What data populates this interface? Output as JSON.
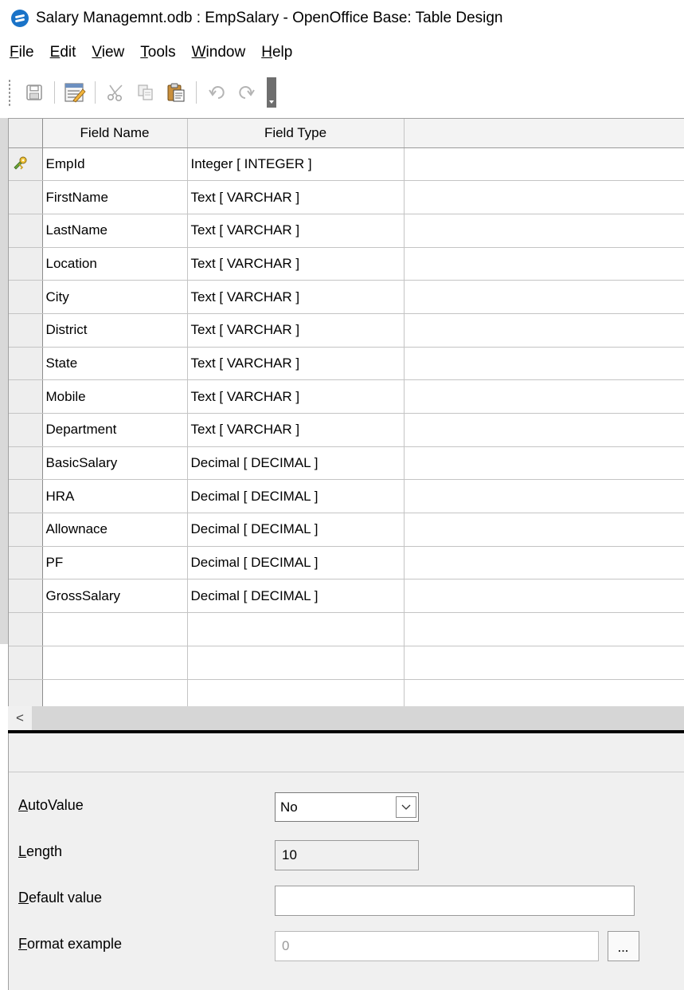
{
  "window": {
    "title": "Salary Managemnt.odb : EmpSalary - OpenOffice Base: Table Design",
    "app_icon": "openoffice-gull-icon"
  },
  "menu": {
    "items": [
      {
        "mnemonic": "F",
        "rest": "ile"
      },
      {
        "mnemonic": "E",
        "rest": "dit"
      },
      {
        "mnemonic": "V",
        "rest": "iew"
      },
      {
        "mnemonic": "T",
        "rest": "ools"
      },
      {
        "mnemonic": "W",
        "rest": "indow"
      },
      {
        "mnemonic": "H",
        "rest": "elp"
      }
    ]
  },
  "toolbar": {
    "icons": [
      "save-icon",
      "edit-design-icon",
      "cut-icon",
      "copy-icon",
      "paste-icon",
      "undo-icon",
      "redo-icon",
      "toolbar-overflow-icon"
    ]
  },
  "grid": {
    "columns": [
      "Field Name",
      "Field Type",
      ""
    ],
    "primary_key_row": 0,
    "rows": [
      {
        "name": "EmpId",
        "type": "Integer [ INTEGER ]"
      },
      {
        "name": "FirstName",
        "type": "Text [ VARCHAR ]"
      },
      {
        "name": "LastName",
        "type": "Text [ VARCHAR ]"
      },
      {
        "name": "Location",
        "type": "Text [ VARCHAR ]"
      },
      {
        "name": "City",
        "type": "Text [ VARCHAR ]"
      },
      {
        "name": "District",
        "type": "Text [ VARCHAR ]"
      },
      {
        "name": "State",
        "type": "Text [ VARCHAR ]"
      },
      {
        "name": "Mobile",
        "type": "Text [ VARCHAR ]"
      },
      {
        "name": "Department",
        "type": "Text [ VARCHAR ]"
      },
      {
        "name": "BasicSalary",
        "type": "Decimal [ DECIMAL ]"
      },
      {
        "name": "HRA",
        "type": "Decimal [ DECIMAL ]"
      },
      {
        "name": "Allownace",
        "type": "Decimal [ DECIMAL ]"
      },
      {
        "name": "PF",
        "type": "Decimal [ DECIMAL ]"
      },
      {
        "name": "GrossSalary",
        "type": "Decimal [ DECIMAL ]"
      },
      {
        "name": "",
        "type": ""
      },
      {
        "name": "",
        "type": ""
      },
      {
        "name": "",
        "type": ""
      }
    ]
  },
  "scrollbar": {
    "left_arrow": "<"
  },
  "properties": {
    "autovalue": {
      "mnemonic": "A",
      "rest": "utoValue",
      "value": "No"
    },
    "length": {
      "mnemonic": "L",
      "rest": "ength",
      "value": "10"
    },
    "default_value": {
      "mnemonic": "D",
      "rest": "efault value",
      "value": ""
    },
    "format_example": {
      "mnemonic": "F",
      "rest": "ormat example",
      "value": "0",
      "button": "..."
    }
  }
}
